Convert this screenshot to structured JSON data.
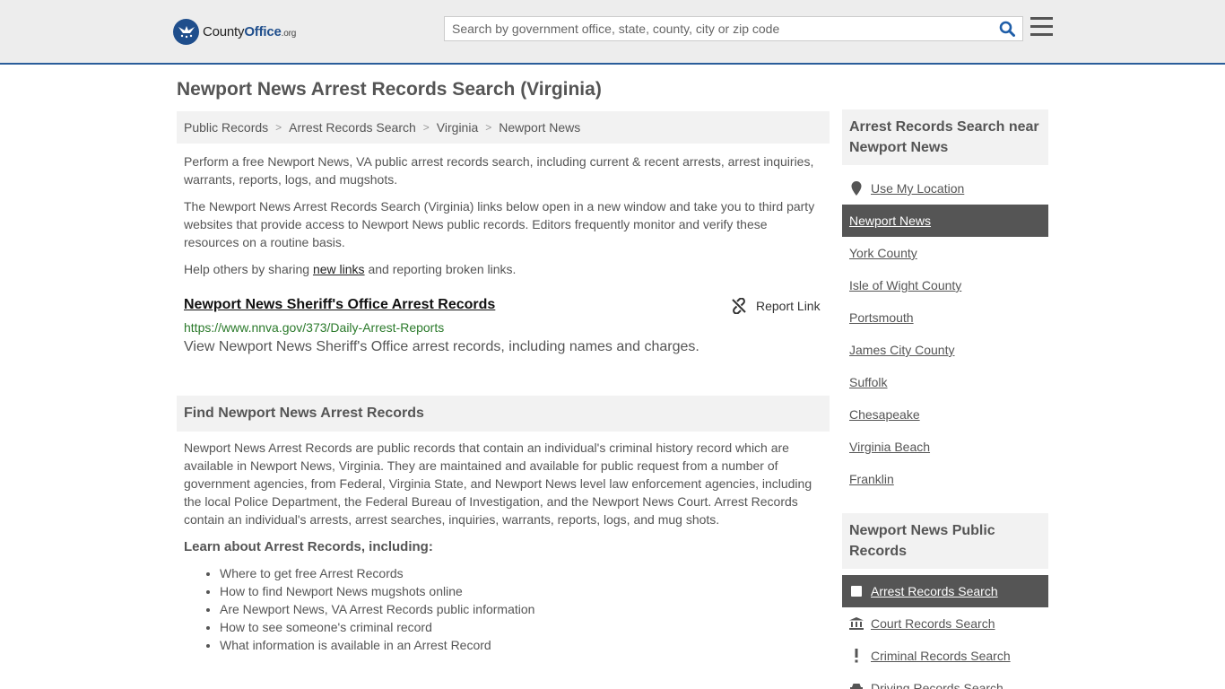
{
  "header": {
    "logo_county": "County",
    "logo_office": "Office",
    "logo_org": ".org",
    "search_placeholder": "Search by government office, state, county, city or zip code"
  },
  "page_title": "Newport News Arrest Records Search (Virginia)",
  "breadcrumb": [
    "Public Records",
    "Arrest Records Search",
    "Virginia",
    "Newport News"
  ],
  "intro": {
    "p1": "Perform a free Newport News, VA public arrest records search, including current & recent arrests, arrest inquiries, warrants, reports, logs, and mugshots.",
    "p2": "The Newport News Arrest Records Search (Virginia) links below open in a new window and take you to third party websites that provide access to Newport News public records. Editors frequently monitor and verify these resources on a routine basis.",
    "p3_before": "Help others by sharing ",
    "p3_link": "new links",
    "p3_after": " and reporting broken links."
  },
  "result": {
    "title": "Newport News Sheriff's Office Arrest Records",
    "report_label": "Report Link",
    "url": "https://www.nnva.gov/373/Daily-Arrest-Reports",
    "description": "View Newport News Sheriff's Office arrest records, including names and charges."
  },
  "find_section": {
    "heading": "Find Newport News Arrest Records",
    "body": "Newport News Arrest Records are public records that contain an individual's criminal history record which are available in Newport News, Virginia. They are maintained and available for public request from a number of government agencies, from Federal, Virginia State, and Newport News level law enforcement agencies, including the local Police Department, the Federal Bureau of Investigation, and the Newport News Court. Arrest Records contain an individual's arrests, arrest searches, inquiries, warrants, reports, logs, and mug shots.",
    "learn_heading": "Learn about Arrest Records, including:",
    "bullets": [
      "Where to get free Arrest Records",
      "How to find Newport News mugshots online",
      "Are Newport News, VA Arrest Records public information",
      "How to see someone's criminal record",
      "What information is available in an Arrest Record"
    ]
  },
  "sidebar": {
    "near_heading": "Arrest Records Search near Newport News",
    "use_location": "Use My Location",
    "near_items": [
      "Newport News",
      "York County",
      "Isle of Wight County",
      "Portsmouth",
      "James City County",
      "Suffolk",
      "Chesapeake",
      "Virginia Beach",
      "Franklin"
    ],
    "public_heading": "Newport News Public Records",
    "public_items": [
      {
        "label": "Arrest Records Search",
        "icon": "checkbox-icon"
      },
      {
        "label": "Court Records Search",
        "icon": "courthouse-icon"
      },
      {
        "label": "Criminal Records Search",
        "icon": "exclamation-icon"
      },
      {
        "label": "Driving Records Search",
        "icon": "car-icon"
      }
    ]
  },
  "colors": {
    "brand_blue": "#1f4e8c",
    "active_bg": "#555555",
    "url_green": "#2b7a2b"
  }
}
